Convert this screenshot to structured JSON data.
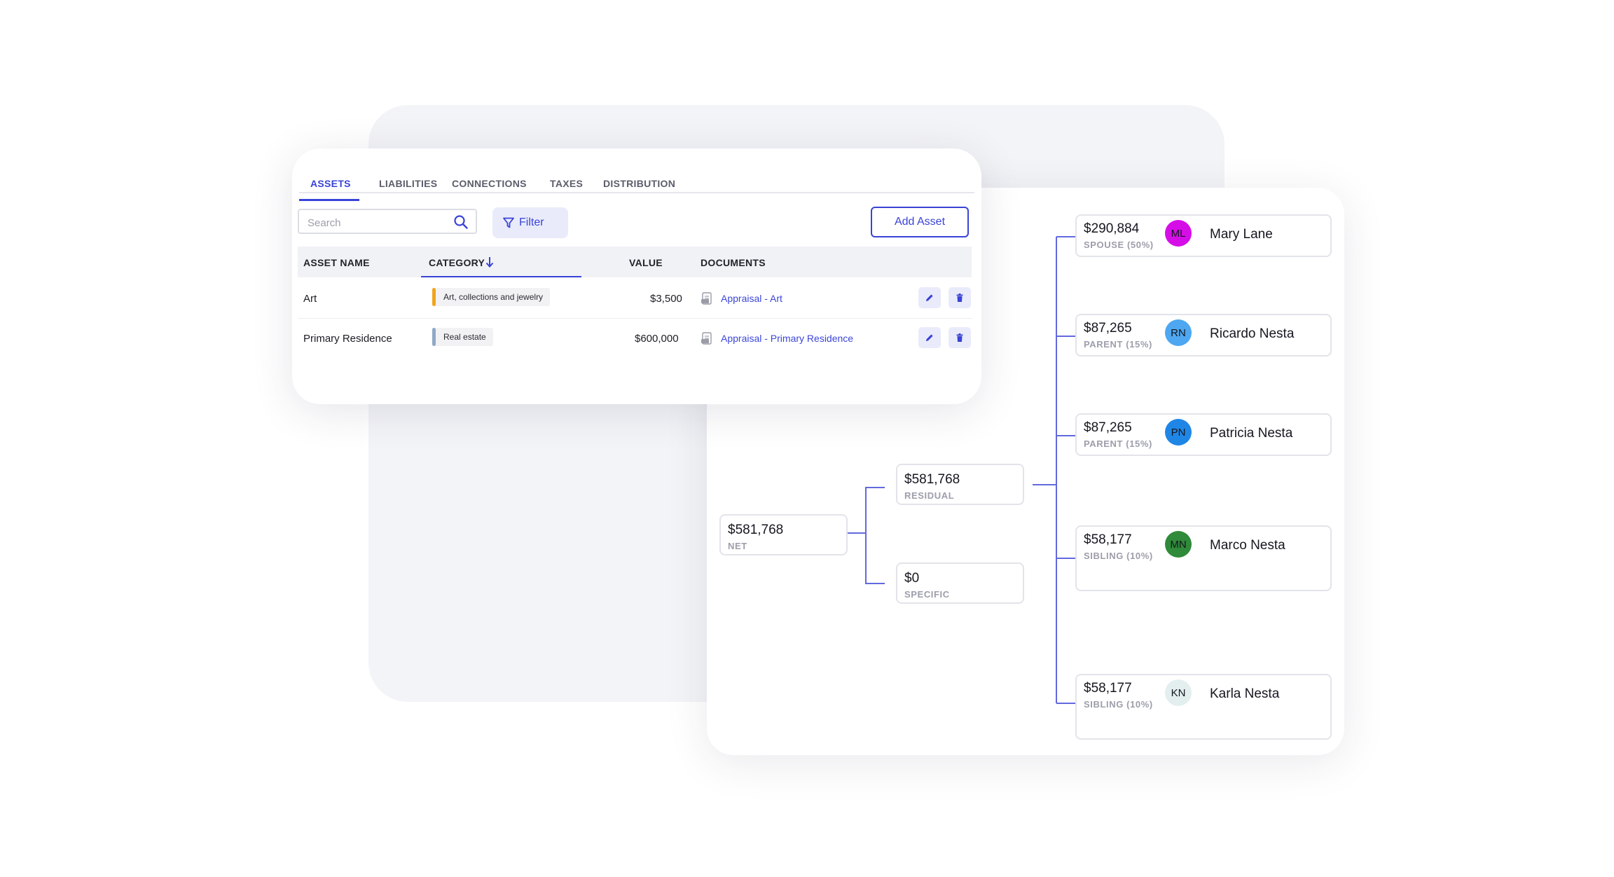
{
  "assets_panel": {
    "tabs": [
      {
        "label": "ASSETS",
        "active": true
      },
      {
        "label": "LIABILITIES",
        "active": false
      },
      {
        "label": "CONNECTIONS",
        "active": false
      },
      {
        "label": "TAXES",
        "active": false
      },
      {
        "label": "DISTRIBUTION",
        "active": false
      }
    ],
    "search": {
      "placeholder": "Search",
      "value": "",
      "icon": "search-icon"
    },
    "filter_label": "Filter",
    "add_label": "Add Asset",
    "columns": {
      "asset_name": "ASSET NAME",
      "category": "CATEGORY",
      "category_sort": "descending",
      "value": "VALUE",
      "documents": "DOCUMENTS"
    },
    "rows": [
      {
        "name": "Art",
        "category": "Art, collections and jewelry",
        "category_color": "#f0a51f",
        "value": "$3,500",
        "document": "Appraisal - Art"
      },
      {
        "name": "Primary Residence",
        "category": "Real estate",
        "category_color": "#8fa9c6",
        "value": "$600,000",
        "document": "Appraisal - Primary Residence"
      }
    ]
  },
  "distribution_tree": {
    "net": {
      "amount": "$581,768",
      "label": "NET"
    },
    "residual": {
      "amount": "$581,768",
      "label": "RESIDUAL"
    },
    "specific": {
      "amount": "$0",
      "label": "SPECIFIC"
    },
    "beneficiaries": [
      {
        "amount": "$290,884",
        "relation": "SPOUSE (50%)",
        "initials": "ML",
        "name": "Mary Lane",
        "avatar_color": "#d50ee8"
      },
      {
        "amount": "$87,265",
        "relation": "PARENT (15%)",
        "initials": "RN",
        "name": "Ricardo Nesta",
        "avatar_color": "#4ea7f0"
      },
      {
        "amount": "$87,265",
        "relation": "PARENT (15%)",
        "initials": "PN",
        "name": "Patricia Nesta",
        "avatar_color": "#1f86e6"
      },
      {
        "amount": "$58,177",
        "relation": "SIBLING (10%)",
        "initials": "MN",
        "name": "Marco Nesta",
        "avatar_color": "#2f8a39"
      },
      {
        "amount": "$58,177",
        "relation": "SIBLING (10%)",
        "initials": "KN",
        "name": "Karla Nesta",
        "avatar_color": "#e3efee"
      }
    ]
  },
  "colors": {
    "accent": "#3943d6",
    "accent_soft": "#e9ebfb",
    "line": "#6269de"
  }
}
